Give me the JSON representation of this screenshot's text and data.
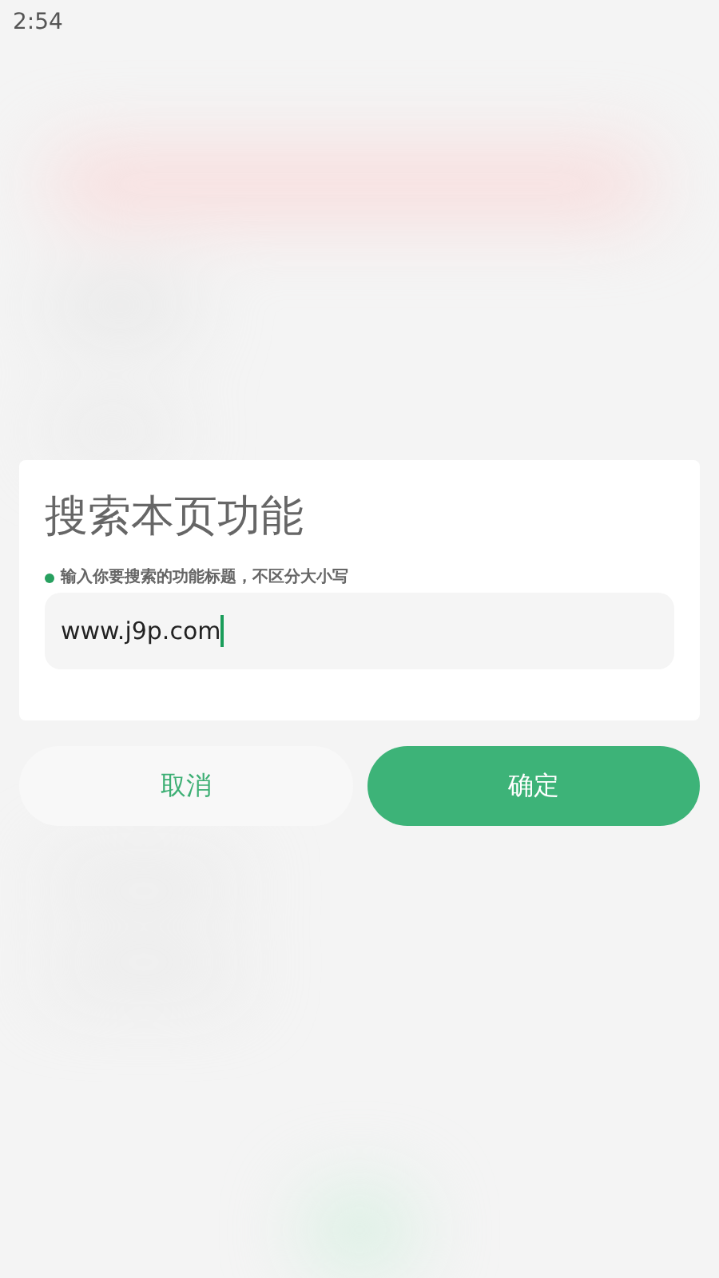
{
  "status_bar": {
    "time": "2:54"
  },
  "dialog": {
    "title": "搜索本页功能",
    "hint": "输入你要搜索的功能标题，不区分大小写",
    "field": {
      "value": "www.j9p.com",
      "focused": true
    }
  },
  "buttons": [
    {
      "label": "取消",
      "kind": "secondary"
    },
    {
      "label": "确定",
      "kind": "primary"
    }
  ]
}
